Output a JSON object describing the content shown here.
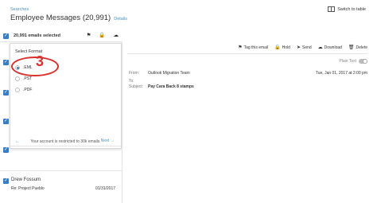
{
  "header": {
    "breadcrumb": "Searches",
    "title": "Employee Messages (20,991)",
    "details_link": "Details",
    "switch_label": "Switch to table"
  },
  "selection": {
    "label": "20,991 emails selected",
    "icons": [
      "tag-icon",
      "lock-icon",
      "cloud-download-icon"
    ]
  },
  "export_dialog": {
    "title": "Select Format",
    "options": [
      {
        "label": ".EML",
        "selected": true
      },
      {
        "label": ".PST",
        "selected": false
      },
      {
        "label": ".PDF",
        "selected": false
      }
    ],
    "annotation_number": "3",
    "back_label": "←",
    "next_label": "Next",
    "restriction_text": "Your account is restricted to 30k emails."
  },
  "message_list": {
    "items": [
      {
        "name": "Drew Fossum",
        "subject": "Re: Project Pueblo",
        "date": "01/31/2017"
      }
    ]
  },
  "preview": {
    "toolbar": [
      {
        "icon": "tag-icon",
        "label": "Tag this email"
      },
      {
        "icon": "lock-icon",
        "label": "Hold"
      },
      {
        "icon": "send-icon",
        "label": "Send"
      },
      {
        "icon": "download-icon",
        "label": "Download"
      },
      {
        "icon": "trash-icon",
        "label": "Delete"
      }
    ],
    "plain_text_label": "Plain Text",
    "from_label": "From:",
    "from_value": "Outlook Migration Team",
    "date_value": "Tue, Jan 01, 2017 at 2:00 pm",
    "to_label": "To:",
    "to_value": "",
    "subject_label": "Subject:",
    "subject_value": "Pay Cara Back 8 stamps"
  },
  "colors": {
    "accent": "#3b7dc4",
    "link": "#4a90c2",
    "annotation": "#d9322e"
  }
}
